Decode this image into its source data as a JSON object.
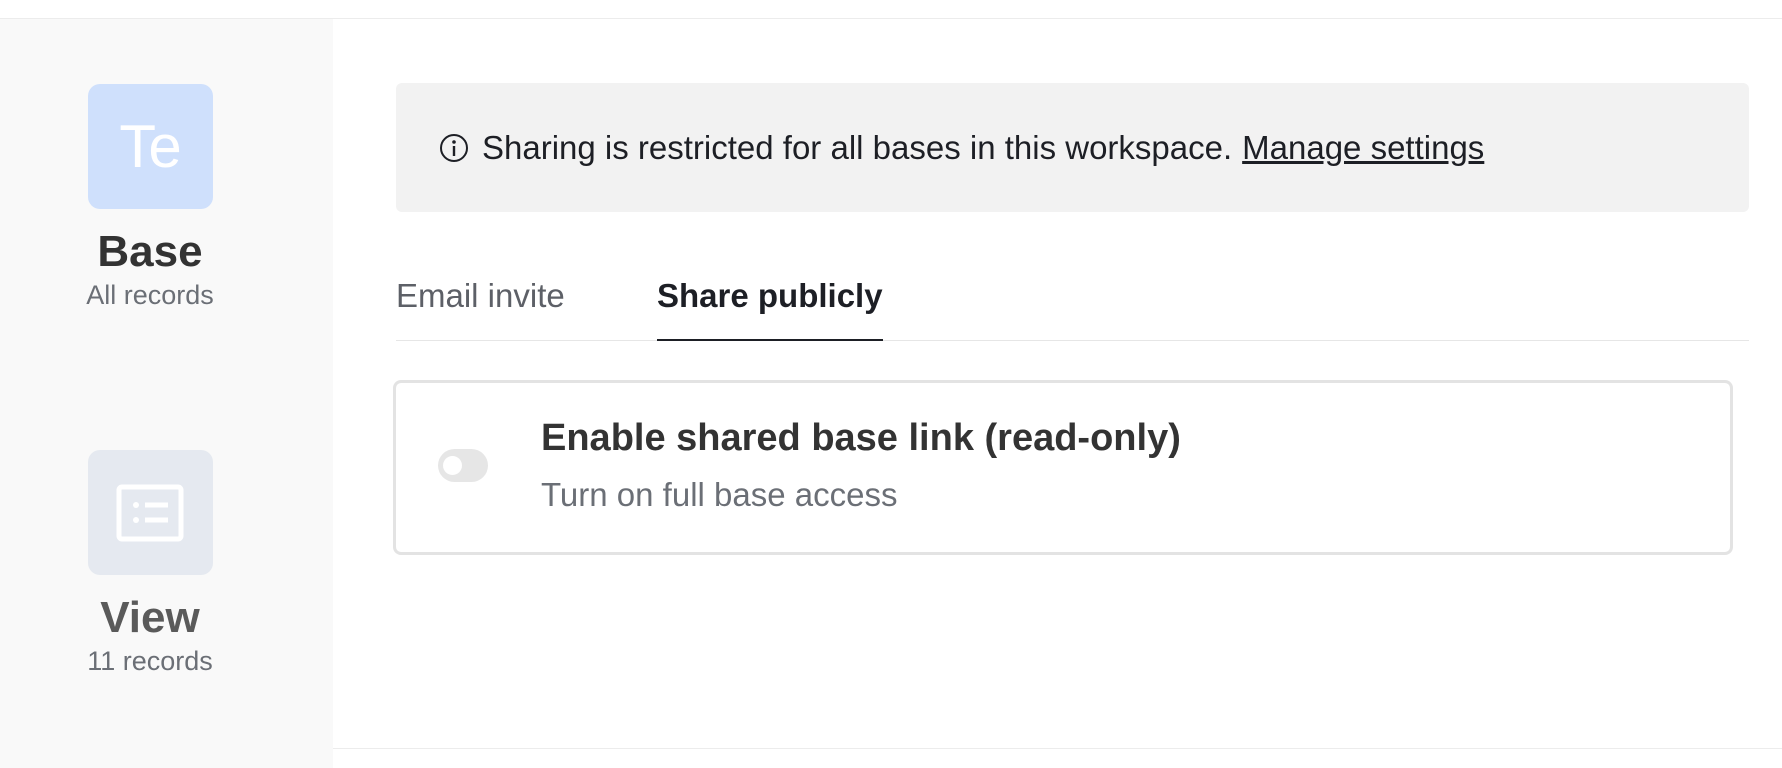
{
  "sidebar": {
    "base": {
      "tile_text": "Te",
      "title": "Base",
      "subtitle": "All records"
    },
    "view": {
      "icon": "list-view-icon",
      "title": "View",
      "subtitle": "11 records"
    }
  },
  "banner": {
    "icon": "info-icon",
    "text": "Sharing is restricted for all bases in this workspace.",
    "link_label": "Manage settings"
  },
  "tabs": [
    {
      "label": "Email invite",
      "active": false
    },
    {
      "label": "Share publicly",
      "active": true
    }
  ],
  "shared_link": {
    "enabled": false,
    "title": "Enable shared base link (read-only)",
    "subtitle": "Turn on full base access"
  },
  "colors": {
    "base_tile": "#cfe0fc",
    "view_tile": "#e5e9f0",
    "banner_bg": "#f2f2f2",
    "toggle_off": "#e6e6e6"
  }
}
